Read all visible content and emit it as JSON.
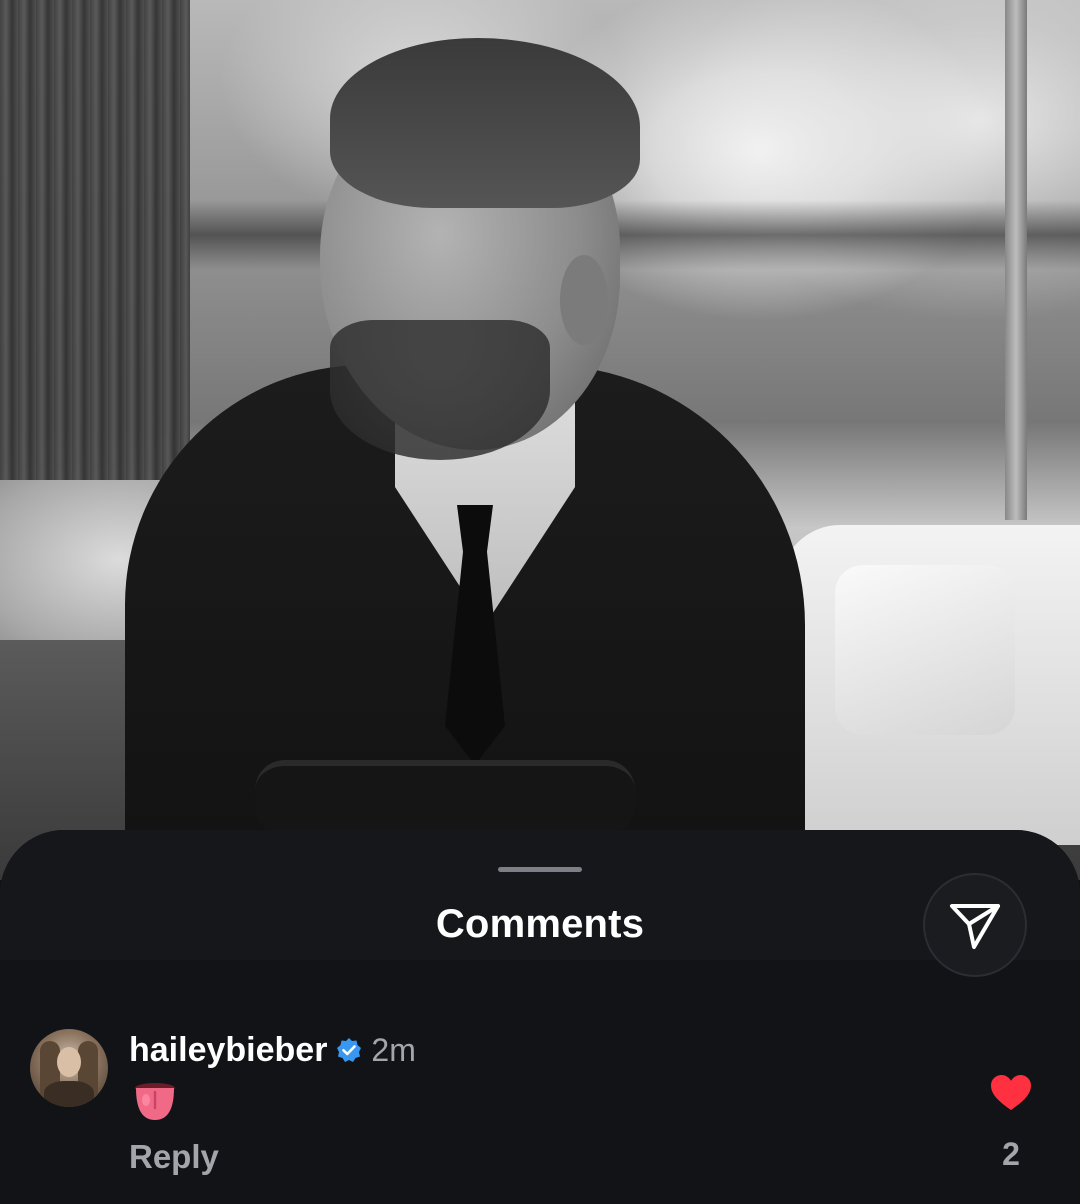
{
  "sheet": {
    "title": "Comments"
  },
  "icons": {
    "share": "paper-plane-icon",
    "verified": "verified-badge-icon",
    "like": "heart-icon",
    "emoji": "tongue-emoji"
  },
  "comments": [
    {
      "username": "haileybieber",
      "verified": true,
      "time": "2m",
      "text": "👅",
      "reply_label": "Reply",
      "likes": "2",
      "liked": true
    }
  ],
  "colors": {
    "sheet_background": "#121317",
    "like_red": "#ff3040",
    "verified_blue": "#3897f0",
    "secondary_text": "#a3a5ab"
  }
}
